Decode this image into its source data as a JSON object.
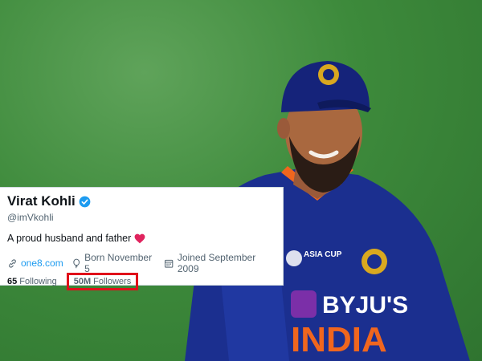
{
  "profile": {
    "display_name": "Virat Kohli",
    "handle": "@imVkohli",
    "bio": "A proud husband and father",
    "website": "one8.com",
    "born": "Born November 5",
    "joined": "Joined September 2009",
    "following_count": "65",
    "following_label": "Following",
    "followers_count": "50M",
    "followers_label": "Followers"
  },
  "jersey": {
    "brand": "BYJU'S",
    "country": "INDIA",
    "event": "ASIA CUP"
  },
  "icons": {
    "verified": "verified-badge-icon",
    "heart": "heart-icon",
    "link": "link-icon",
    "birthday": "balloon-icon",
    "calendar": "calendar-icon"
  },
  "colors": {
    "accent": "#1d9bf0",
    "highlight_box": "#e0101a",
    "heart": "#e0245e",
    "jersey_blue": "#1b2f8f",
    "field_green": "#3f8a3a"
  }
}
